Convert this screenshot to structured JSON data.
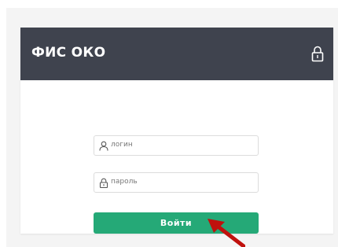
{
  "header": {
    "title": "ФИС ОКО",
    "icon": "lock-icon"
  },
  "form": {
    "login": {
      "placeholder": "логин",
      "icon": "user-icon"
    },
    "password": {
      "placeholder": "пароль",
      "icon": "lock-icon"
    },
    "submit_label": "Войти"
  },
  "colors": {
    "header_bg": "#3f434e",
    "button_bg": "#25a977",
    "arrow": "#c0110d"
  }
}
